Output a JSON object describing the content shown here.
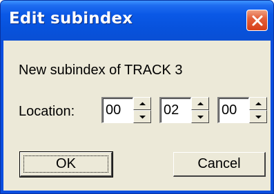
{
  "window": {
    "title": "Edit subindex"
  },
  "dialog": {
    "subtitle": "New subindex of TRACK 3",
    "location_label": "Location:",
    "location_fields": [
      {
        "value": "00"
      },
      {
        "value": "02"
      },
      {
        "value": "00"
      }
    ]
  },
  "buttons": {
    "ok_label": "OK",
    "cancel_label": "Cancel"
  },
  "icons": {
    "close": "close-icon",
    "spin_up": "spin-up-arrow-icon",
    "spin_down": "spin-down-arrow-icon"
  },
  "colors": {
    "titlebar": "#0a58e6",
    "client": "#ece9d8",
    "close_button": "#e4603a"
  }
}
